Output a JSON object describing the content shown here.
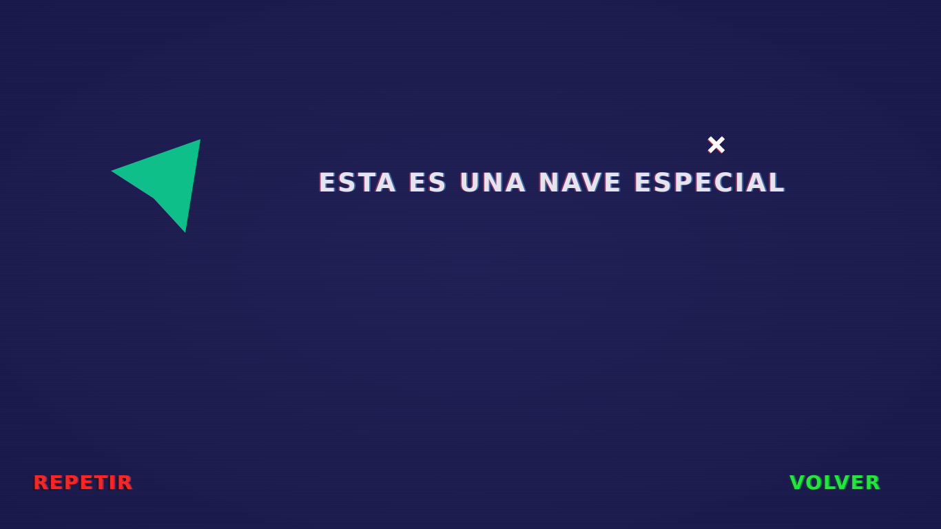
{
  "scene": {
    "background_color": "#1c1c4f",
    "ship": {
      "icon": "arrow-ship-icon",
      "color": "#0fbf8a"
    },
    "message": "ESTA ES UNA NAVE ESPECIAL",
    "close_icon": "close-icon"
  },
  "controls": {
    "repeat_label": "REPETIR",
    "repeat_color": "#ff2424",
    "back_label": "VOLVER",
    "back_color": "#1ee83a"
  }
}
